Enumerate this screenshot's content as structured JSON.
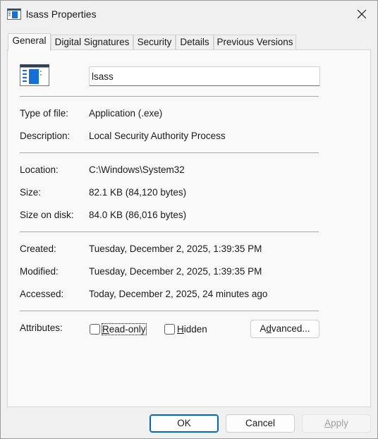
{
  "window": {
    "title": "lsass Properties",
    "icon": "application-file-icon"
  },
  "tabs": [
    {
      "label": "General",
      "active": true
    },
    {
      "label": "Digital Signatures",
      "active": false
    },
    {
      "label": "Security",
      "active": false
    },
    {
      "label": "Details",
      "active": false
    },
    {
      "label": "Previous Versions",
      "active": false
    }
  ],
  "general": {
    "file_name": "lsass",
    "type_of_file": {
      "label": "Type of file:",
      "value": "Application (.exe)"
    },
    "description": {
      "label": "Description:",
      "value": "Local Security Authority Process"
    },
    "location": {
      "label": "Location:",
      "value": "C:\\Windows\\System32"
    },
    "size": {
      "label": "Size:",
      "value": "82.1 KB (84,120 bytes)"
    },
    "size_on_disk": {
      "label": "Size on disk:",
      "value": "84.0 KB (86,016 bytes)"
    },
    "created": {
      "label": "Created:",
      "value": "Tuesday, December 2, 2025, 1:39:35 PM"
    },
    "modified": {
      "label": "Modified:",
      "value": "Tuesday, December 2, 2025, 1:39:35 PM"
    },
    "accessed": {
      "label": "Accessed:",
      "value": "Today, December 2, 2025, 24 minutes ago"
    },
    "attributes": {
      "label": "Attributes:",
      "read_only": {
        "label_pre": "",
        "label_accel": "R",
        "label_post": "ead-only",
        "checked": false
      },
      "hidden": {
        "label_pre": "",
        "label_accel": "H",
        "label_post": "idden",
        "checked": false
      },
      "advanced": {
        "label_pre": "A",
        "label_accel": "d",
        "label_post": "vanced..."
      }
    }
  },
  "buttons": {
    "ok": "OK",
    "cancel": "Cancel",
    "apply": {
      "label_pre": "",
      "label_accel": "A",
      "label_post": "pply",
      "enabled": false
    }
  },
  "colors": {
    "accent": "#0067c0",
    "window_bg": "#f0f0f0",
    "pane_bg": "#f9f9f9"
  }
}
